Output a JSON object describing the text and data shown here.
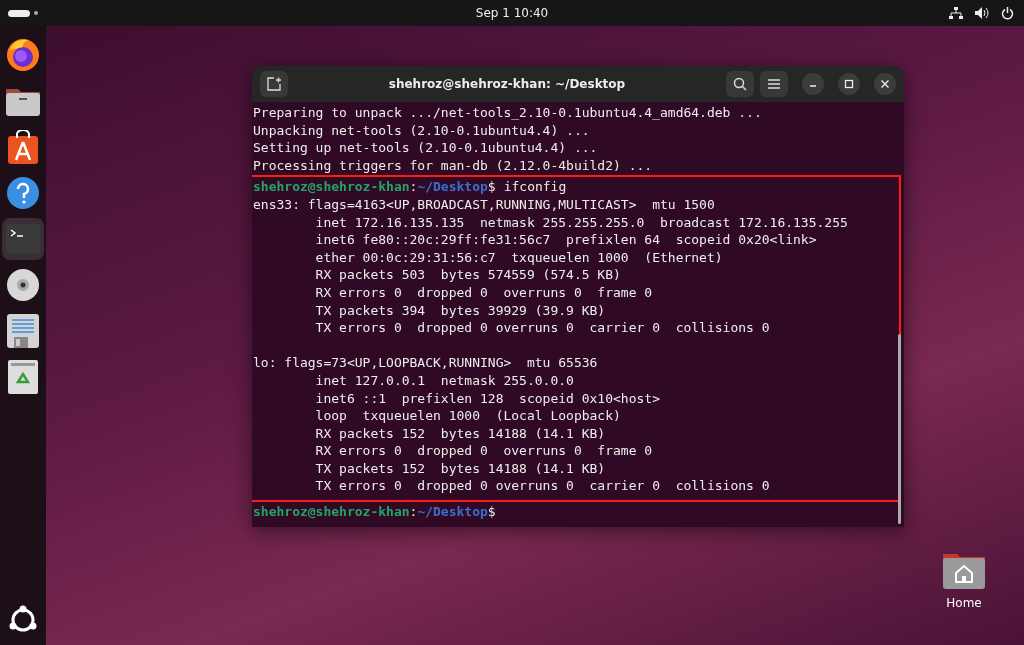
{
  "top_bar": {
    "clock": "Sep 1  10:40"
  },
  "dock": {
    "items": [
      {
        "kind": "browser",
        "running": false
      },
      {
        "kind": "files",
        "running": false
      },
      {
        "kind": "store",
        "running": false
      },
      {
        "kind": "help",
        "running": false
      },
      {
        "kind": "terminal",
        "running": true
      },
      {
        "kind": "disc",
        "running": false
      },
      {
        "kind": "editor",
        "running": false
      },
      {
        "kind": "trash",
        "running": false
      }
    ]
  },
  "window": {
    "title": "shehroz@shehroz-khan: ~/Desktop",
    "blocks": [
      {
        "highlighted": false,
        "lines": [
          {
            "kind": "output",
            "text": "Preparing to unpack .../net-tools_2.10-0.1ubuntu4.4_amd64.deb ..."
          },
          {
            "kind": "output",
            "text": "Unpacking net-tools (2.10-0.1ubuntu4.4) ..."
          },
          {
            "kind": "output",
            "text": "Setting up net-tools (2.10-0.1ubuntu4.4) ..."
          },
          {
            "kind": "output",
            "text": "Processing triggers for man-db (2.12.0-4build2) ..."
          }
        ]
      },
      {
        "highlighted": true,
        "lines": [
          {
            "kind": "prompt",
            "user": "shehroz@shehroz-khan",
            "separator": ":",
            "path": "~/Desktop",
            "symbol": "$",
            "command": "ifconfig"
          },
          {
            "kind": "output",
            "text": "ens33: flags=4163<UP,BROADCAST,RUNNING,MULTICAST>  mtu 1500"
          },
          {
            "kind": "output",
            "text": "        inet 172.16.135.135  netmask 255.255.255.0  broadcast 172.16.135.255"
          },
          {
            "kind": "output",
            "text": "        inet6 fe80::20c:29ff:fe31:56c7  prefixlen 64  scopeid 0x20<link>"
          },
          {
            "kind": "output",
            "text": "        ether 00:0c:29:31:56:c7  txqueuelen 1000  (Ethernet)"
          },
          {
            "kind": "output",
            "text": "        RX packets 503  bytes 574559 (574.5 KB)"
          },
          {
            "kind": "output",
            "text": "        RX errors 0  dropped 0  overruns 0  frame 0"
          },
          {
            "kind": "output",
            "text": "        TX packets 394  bytes 39929 (39.9 KB)"
          },
          {
            "kind": "output",
            "text": "        TX errors 0  dropped 0 overruns 0  carrier 0  collisions 0"
          },
          {
            "kind": "blank"
          },
          {
            "kind": "output",
            "text": "lo: flags=73<UP,LOOPBACK,RUNNING>  mtu 65536"
          },
          {
            "kind": "output",
            "text": "        inet 127.0.0.1  netmask 255.0.0.0"
          },
          {
            "kind": "output",
            "text": "        inet6 ::1  prefixlen 128  scopeid 0x10<host>"
          },
          {
            "kind": "output",
            "text": "        loop  txqueuelen 1000  (Local Loopback)"
          },
          {
            "kind": "output",
            "text": "        RX packets 152  bytes 14188 (14.1 KB)"
          },
          {
            "kind": "output",
            "text": "        RX errors 0  dropped 0  overruns 0  frame 0"
          },
          {
            "kind": "output",
            "text": "        TX packets 152  bytes 14188 (14.1 KB)"
          },
          {
            "kind": "output",
            "text": "        TX errors 0  dropped 0 overruns 0  carrier 0  collisions 0"
          }
        ]
      },
      {
        "highlighted": false,
        "lines": [
          {
            "kind": "prompt",
            "user": "shehroz@shehroz-khan",
            "separator": ":",
            "path": "~/Desktop",
            "symbol": "$"
          }
        ]
      }
    ]
  },
  "desktop_icons": [
    {
      "label": "Home"
    }
  ]
}
